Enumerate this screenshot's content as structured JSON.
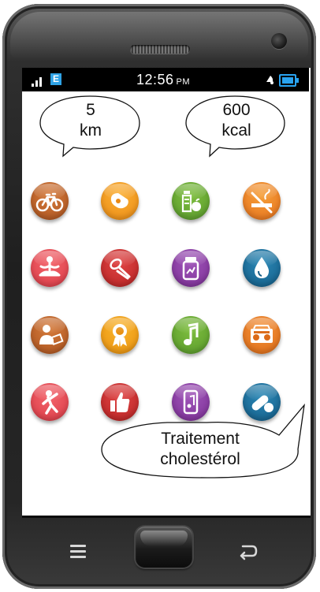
{
  "status_bar": {
    "network_badge": "E",
    "time": "12:56",
    "ampm": "PM"
  },
  "bubbles": {
    "distance": {
      "line1": "5",
      "line2": "km"
    },
    "calories": {
      "line1": "600",
      "line2": "kcal"
    },
    "treatment": {
      "line1": "Traitement",
      "line2": "cholestérol"
    }
  },
  "apps": [
    {
      "icon": "bicycle-icon",
      "color": "#c0652b"
    },
    {
      "icon": "whistle-icon",
      "color": "#f5a12a"
    },
    {
      "icon": "water-bottle-apple-icon",
      "color": "#6aab35"
    },
    {
      "icon": "no-smoking-icon",
      "color": "#ee8428"
    },
    {
      "icon": "meditation-icon",
      "color": "#e8505a"
    },
    {
      "icon": "skipping-rope-icon",
      "color": "#cc3333"
    },
    {
      "icon": "medicine-jar-icon",
      "color": "#8b3fa6"
    },
    {
      "icon": "water-drop-icon",
      "color": "#1d6e9c"
    },
    {
      "icon": "doctor-prescription-icon",
      "color": "#b86a2a"
    },
    {
      "icon": "medal-ribbon-icon",
      "color": "#f3a41f"
    },
    {
      "icon": "music-note-icon",
      "color": "#6aab35"
    },
    {
      "icon": "radio-icon",
      "color": "#e87a25"
    },
    {
      "icon": "stretching-icon",
      "color": "#ea5155"
    },
    {
      "icon": "thumbs-up-icon",
      "color": "#d63131"
    },
    {
      "icon": "music-phone-icon",
      "color": "#8b3fa6"
    },
    {
      "icon": "pills-icon",
      "color": "#1d6e9c"
    }
  ]
}
